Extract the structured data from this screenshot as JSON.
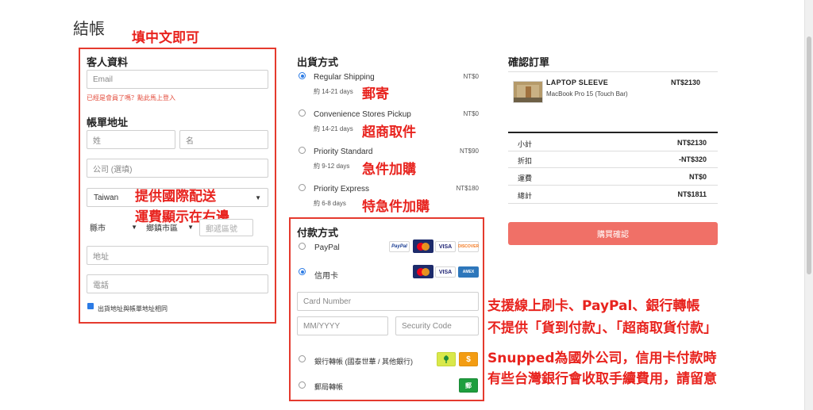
{
  "page": {
    "title": "結帳"
  },
  "annotations": {
    "top": "填中文即可",
    "intl_line1": "提供國際配送",
    "intl_line2": "運費顯示在右邊",
    "post": "郵寄",
    "store": "超商取件",
    "express": "急件加購",
    "express_plus": "特急件加購",
    "pay_line1": "支援線上刷卡、PayPal、銀行轉帳",
    "pay_line2": "不提供「貨到付款」、「超商取貨付款」",
    "fee_line1": "Snupped為國外公司，信用卡付款時",
    "fee_line2": "有些台灣銀行會收取手續費用，請留意"
  },
  "customer": {
    "title": "客人資料",
    "email_placeholder": "Email",
    "login_hint": "已經是會員了嗎？點此馬上登入"
  },
  "billing": {
    "title": "帳單地址",
    "last_name_placeholder": "姓",
    "first_name_placeholder": "名",
    "company_placeholder": "公司 (選填)",
    "country": "Taiwan",
    "county": "縣市",
    "district": "鄉鎮市區",
    "postal_placeholder": "郵遞區號",
    "address_placeholder": "地址",
    "phone_placeholder": "電話",
    "same_address_label": "出貨地址與帳單地址相同"
  },
  "shipping": {
    "title": "出貨方式",
    "options": [
      {
        "name": "Regular Shipping",
        "days": "約 14-21 days",
        "price": "NT$0",
        "selected": true
      },
      {
        "name": "Convenience Stores Pickup",
        "days": "約 14-21 days",
        "price": "NT$0",
        "selected": false
      },
      {
        "name": "Priority Standard",
        "days": "約 9-12 days",
        "price": "NT$90",
        "selected": false
      },
      {
        "name": "Priority Express",
        "days": "約 6-8 days",
        "price": "NT$180",
        "selected": false
      }
    ]
  },
  "payment": {
    "title": "付款方式",
    "paypal_label": "PayPal",
    "card_label": "信用卡",
    "card_number_placeholder": "Card Number",
    "expiry_placeholder": "MM/YYYY",
    "cvc_placeholder": "Security Code",
    "bank_label": "銀行轉帳 (國泰世華 / 其他銀行)",
    "post_label": "郵局轉帳",
    "badges": {
      "paypal": "PayPal",
      "visa": "VISA",
      "discover": "DISCOVER",
      "amex": "AMEX",
      "dollar": "$",
      "post": "郵"
    }
  },
  "order": {
    "title": "確認訂單",
    "item_name": "LAPTOP SLEEVE",
    "item_variant": "MacBook Pro 15 (Touch Bar)",
    "item_price": "NT$2130",
    "subtotal_label": "小計",
    "subtotal": "NT$2130",
    "discount_label": "折扣",
    "discount": "-NT$320",
    "shipping_label": "運費",
    "shipping": "NT$0",
    "total_label": "總計",
    "total": "NT$1811",
    "confirm_button": "購買確認"
  },
  "colors": {
    "accent": "#2c7be5",
    "confirm": "#f07067",
    "annotation": "#e8231e",
    "hint": "#e34b3b"
  }
}
